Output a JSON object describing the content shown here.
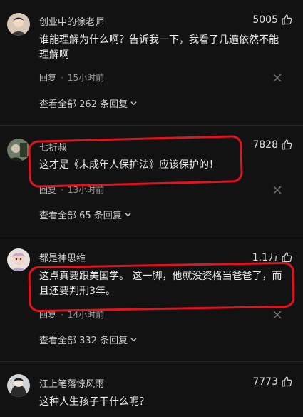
{
  "comments": [
    {
      "username": "创业中的徐老师",
      "likes": "5005",
      "text": "谁能理解为什么啊？告诉我一下，我看了几遍依然不能理解啊",
      "reply_label": "回复",
      "time": "15小时前",
      "view_all": "查看全部 262 条回复"
    },
    {
      "username": "七折叔",
      "likes": "7828",
      "text": "这才是《未成年人保护法》应该保护的！",
      "reply_label": "回复",
      "time": "13小时前",
      "view_all": "查看全部 65 条回复"
    },
    {
      "username": "都是神思维",
      "likes": "1.1万",
      "text": "这点真要跟美国学。 这一脚，他就没资格当爸爸了，而且还要判刑3年。",
      "reply_label": "回复",
      "time": "14小时前",
      "view_all": "查看全部 332 条回复"
    },
    {
      "username": "江上笔落惊风雨",
      "likes": "7773",
      "text": "这种人生孩子干什么呢？"
    }
  ],
  "colors": {
    "background": "#121212",
    "annotation": "#e0141e",
    "meta": "#9a9a9a"
  },
  "icons": {
    "like": "thumbs-up-icon",
    "close": "close-icon",
    "expand": "chevron-down-icon"
  }
}
